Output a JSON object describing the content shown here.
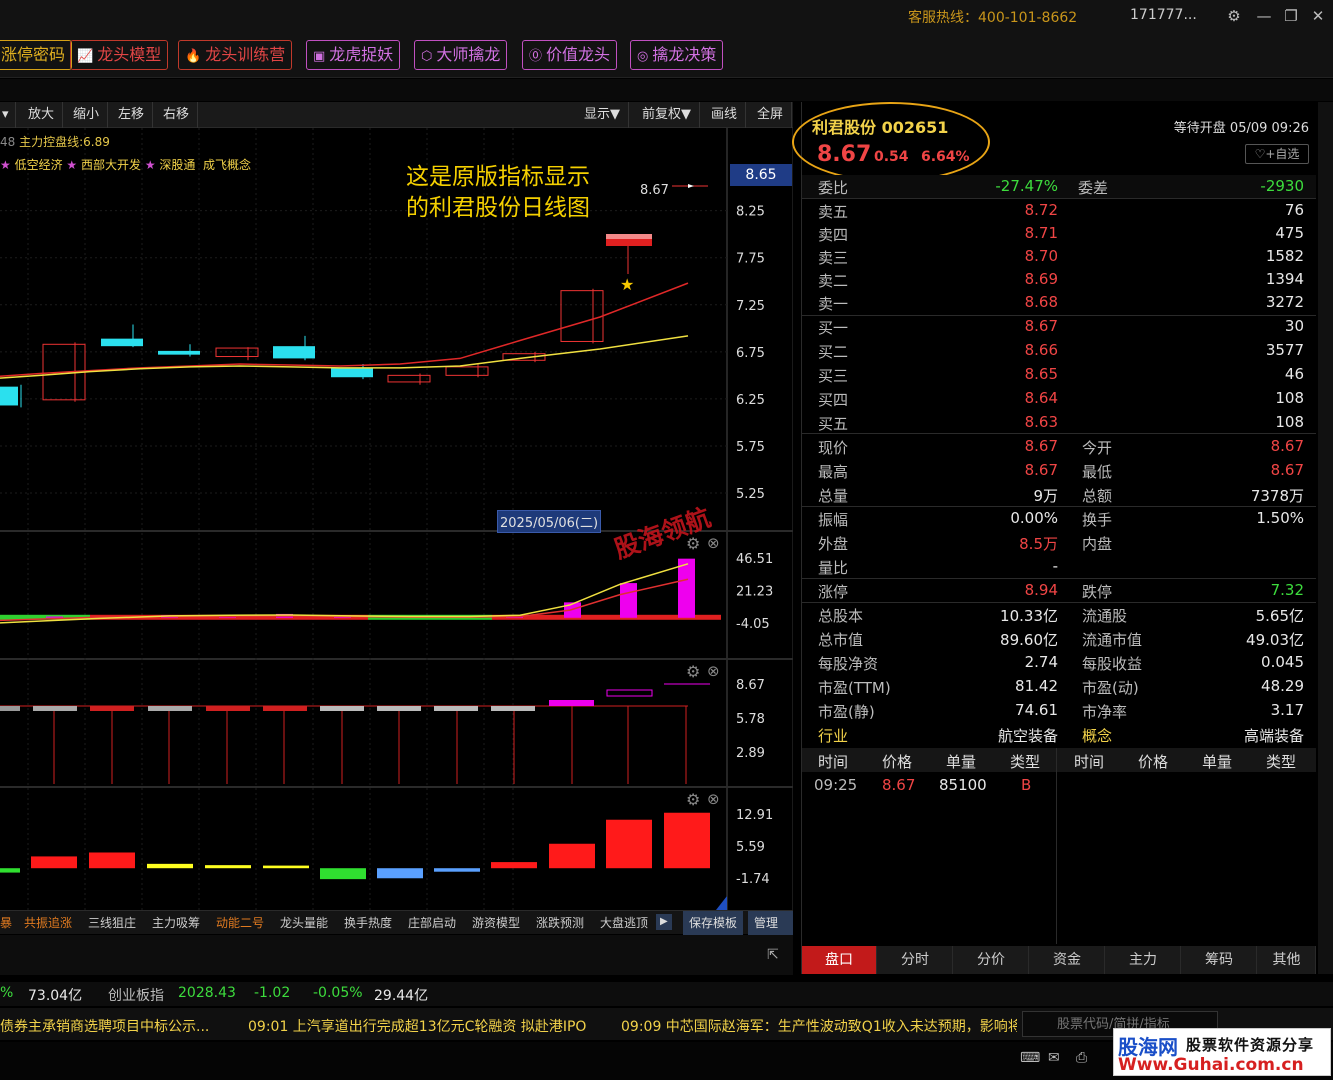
{
  "titlebar": {
    "hotline": "客服热线：400-101-8662",
    "account": "171777...",
    "settings_icon": "gear-icon",
    "minimize_icon": "minimize-icon",
    "restore_icon": "restore-icon",
    "close_icon": "close-icon"
  },
  "features": [
    {
      "label": "涨停密码",
      "icon": ""
    },
    {
      "label": "龙头模型",
      "icon": "chart-icon"
    },
    {
      "label": "龙头训练营",
      "icon": "fire-icon"
    },
    {
      "label": "龙虎捉妖",
      "icon": "frame-icon"
    },
    {
      "label": "大师擒龙",
      "icon": "cube-icon"
    },
    {
      "label": "价值龙头",
      "icon": "coin-icon"
    },
    {
      "label": "擒龙决策",
      "icon": "pulse-icon"
    }
  ],
  "chart_tools": {
    "zoom_in": "放大",
    "zoom_out": "缩小",
    "move_left": "左移",
    "move_right": "右移",
    "display": "显示▼",
    "adjust": "前复权▼",
    "draw": "画线",
    "fullscreen": "全屏"
  },
  "chart_header": {
    "indicator_prefix": "48",
    "indicator_label": "主力控盘线:6.89",
    "concepts": [
      "低空经济",
      "西部大开发",
      "深股通",
      "成飞概念"
    ],
    "annotation_line1": "这是原版指标显示",
    "annotation_line2": "的利君股份日线图",
    "price_tag": "8.65",
    "last_price_label": "8.67",
    "date_tag": "2025/05/06(二)",
    "watermark": "股海领航"
  },
  "chart_data": {
    "type": "candlestick",
    "main_y_ticks": [
      "8.25",
      "7.75",
      "7.25",
      "6.75",
      "6.25",
      "5.75",
      "5.25"
    ],
    "ylim": [
      5.25,
      8.65
    ],
    "candles": [
      {
        "open": 6.38,
        "close": 6.18,
        "high": 6.4,
        "low": 6.16
      },
      {
        "open": 6.24,
        "close": 6.83,
        "high": 6.85,
        "low": 6.22
      },
      {
        "open": 6.89,
        "close": 6.81,
        "high": 7.04,
        "low": 6.8
      },
      {
        "open": 6.76,
        "close": 6.72,
        "high": 6.83,
        "low": 6.7
      },
      {
        "open": 6.7,
        "close": 6.79,
        "high": 6.8,
        "low": 6.66
      },
      {
        "open": 6.81,
        "close": 6.68,
        "high": 6.92,
        "low": 6.66
      },
      {
        "open": 6.58,
        "close": 6.48,
        "high": 6.62,
        "low": 6.46
      },
      {
        "open": 6.43,
        "close": 6.5,
        "high": 6.52,
        "low": 6.4
      },
      {
        "open": 6.5,
        "close": 6.59,
        "high": 6.62,
        "low": 6.48
      },
      {
        "open": 6.66,
        "close": 6.73,
        "high": 6.75,
        "low": 6.64
      },
      {
        "open": 6.86,
        "close": 7.4,
        "high": 7.42,
        "low": 6.84
      },
      {
        "open": 8.67,
        "close": 8.67,
        "high": 8.67,
        "low": 8.67
      }
    ],
    "ma_red": [
      6.49,
      6.52,
      6.55,
      6.58,
      6.6,
      6.62,
      6.61,
      6.6,
      6.62,
      6.68,
      6.87,
      7.12,
      7.48
    ],
    "ma_yellow": [
      6.47,
      6.5,
      6.54,
      6.57,
      6.59,
      6.6,
      6.59,
      6.58,
      6.58,
      6.6,
      6.68,
      6.78,
      6.92
    ],
    "ind1_y_ticks": [
      "46.51",
      "21.23",
      "-4.05"
    ],
    "ind1_bars": [
      -1,
      1,
      1,
      2,
      2,
      3,
      1,
      -1,
      -1,
      1,
      12,
      27,
      46
    ],
    "ind2_y_ticks": [
      "8.67",
      "5.78",
      "2.89"
    ],
    "ind3_y_ticks": [
      "12.91",
      "5.59",
      "-1.74"
    ],
    "ind3_bars": [
      {
        "v": -0.5,
        "c": "#30e030"
      },
      {
        "v": 3.2,
        "c": "#ff1a1a"
      },
      {
        "v": 4.1,
        "c": "#ff1a1a"
      },
      {
        "v": 1.5,
        "c": "#ffff20"
      },
      {
        "v": 1.2,
        "c": "#ffff20"
      },
      {
        "v": 1.1,
        "c": "#ffff20"
      },
      {
        "v": -2.0,
        "c": "#30e030"
      },
      {
        "v": -1.8,
        "c": "#5aa0ff"
      },
      {
        "v": -0.3,
        "c": "#5aa0ff"
      },
      {
        "v": 1.9,
        "c": "#ff1a1a"
      },
      {
        "v": 6.1,
        "c": "#ff1a1a"
      },
      {
        "v": 11.6,
        "c": "#ff1a1a"
      },
      {
        "v": 13.2,
        "c": "#ff1a1a"
      }
    ]
  },
  "indicator_tabs": [
    {
      "label": "暴",
      "color": "orange"
    },
    {
      "label": "共振追涨",
      "color": "orange"
    },
    {
      "label": "三线狙庄",
      "color": "normal"
    },
    {
      "label": "主力吸筹",
      "color": "normal"
    },
    {
      "label": "动能二号",
      "color": "orange"
    },
    {
      "label": "龙头量能",
      "color": "normal"
    },
    {
      "label": "换手热度",
      "color": "normal"
    },
    {
      "label": "庄部启动",
      "color": "normal"
    },
    {
      "label": "游资模型",
      "color": "normal"
    },
    {
      "label": "涨跌预测",
      "color": "normal"
    },
    {
      "label": "大盘逃顶",
      "color": "normal"
    }
  ],
  "indicator_buttons": {
    "more": "▶",
    "save": "保存模板",
    "manage": "管理"
  },
  "quote": {
    "name": "利君股份 002651",
    "price": "8.67",
    "change": "0.54",
    "change_pct": "6.64%",
    "status": "等待开盘 05/09 09:26",
    "fav": "+自选",
    "weibi_label": "委比",
    "weibi": "-27.47%",
    "weicha_label": "委差",
    "weicha": "-2930",
    "asks": [
      {
        "label": "卖五",
        "price": "8.72",
        "vol": "76"
      },
      {
        "label": "卖四",
        "price": "8.71",
        "vol": "475"
      },
      {
        "label": "卖三",
        "price": "8.70",
        "vol": "1582"
      },
      {
        "label": "卖二",
        "price": "8.69",
        "vol": "1394"
      },
      {
        "label": "卖一",
        "price": "8.68",
        "vol": "3272"
      }
    ],
    "bids": [
      {
        "label": "买一",
        "price": "8.67",
        "vol": "30"
      },
      {
        "label": "买二",
        "price": "8.66",
        "vol": "3577"
      },
      {
        "label": "买三",
        "price": "8.65",
        "vol": "46"
      },
      {
        "label": "买四",
        "price": "8.64",
        "vol": "108"
      },
      {
        "label": "买五",
        "price": "8.63",
        "vol": "108"
      }
    ],
    "stats": [
      [
        {
          "l": "现价",
          "v": "8.67",
          "c": "red"
        },
        {
          "l": "今开",
          "v": "8.67",
          "c": "red"
        }
      ],
      [
        {
          "l": "最高",
          "v": "8.67",
          "c": "red"
        },
        {
          "l": "最低",
          "v": "8.67",
          "c": "red"
        }
      ],
      [
        {
          "l": "总量",
          "v": "9万",
          "c": "white"
        },
        {
          "l": "总额",
          "v": "7378万",
          "c": "white"
        }
      ],
      [
        {
          "l": "振幅",
          "v": "0.00%",
          "c": "white"
        },
        {
          "l": "换手",
          "v": "1.50%",
          "c": "white"
        }
      ],
      [
        {
          "l": "外盘",
          "v": "8.5万",
          "c": "red"
        },
        {
          "l": "内盘",
          "v": "",
          "c": "white"
        }
      ],
      [
        {
          "l": "量比",
          "v": "-",
          "c": "white"
        },
        {
          "l": "",
          "v": "",
          "c": "white"
        }
      ],
      [
        {
          "l": "涨停",
          "v": "8.94",
          "c": "red"
        },
        {
          "l": "跌停",
          "v": "7.32",
          "c": "green"
        }
      ],
      [
        {
          "l": "总股本",
          "v": "10.33亿",
          "c": "white"
        },
        {
          "l": "流通股",
          "v": "5.65亿",
          "c": "white"
        }
      ],
      [
        {
          "l": "总市值",
          "v": "89.60亿",
          "c": "white"
        },
        {
          "l": "流通市值",
          "v": "49.03亿",
          "c": "white"
        }
      ],
      [
        {
          "l": "每股净资",
          "v": "2.74",
          "c": "white"
        },
        {
          "l": "每股收益",
          "v": "0.045",
          "c": "white"
        }
      ],
      [
        {
          "l": "市盈(TTM)",
          "v": "81.42",
          "c": "white"
        },
        {
          "l": "市盈(动)",
          "v": "48.29",
          "c": "white"
        }
      ],
      [
        {
          "l": "市盈(静)",
          "v": "74.61",
          "c": "white"
        },
        {
          "l": "市净率",
          "v": "3.17",
          "c": "white"
        }
      ],
      [
        {
          "l": "行业",
          "v": "航空装备",
          "c": "white"
        },
        {
          "l": "概念",
          "v": "高端装备",
          "c": "white"
        }
      ]
    ],
    "tick_headers": [
      "时间",
      "价格",
      "单量",
      "类型",
      "时间",
      "价格",
      "单量",
      "类型"
    ],
    "ticks": [
      {
        "time": "09:25",
        "price": "8.67",
        "vol": "85100",
        "type": "B"
      }
    ],
    "tabs": [
      "盘口",
      "分时",
      "分价",
      "资金",
      "主力",
      "筹码",
      "其他"
    ]
  },
  "index_bar": {
    "pct0": "%",
    "amount0": "73.04亿",
    "name": "创业板指",
    "value": "2028.43",
    "change": "-1.02",
    "pct": "-0.05%",
    "amount": "29.44亿"
  },
  "news": [
    "债券主承销商选聘项目中标公示...",
    "09:01 上汽享道出行完成超13亿元C轮融资 拟赴港IPO",
    "09:09 中芯国际赵海军：生产性波动致Q1收入未达预期，影响将"
  ],
  "search": {
    "placeholder": "股票代码/简拼/指标"
  },
  "watermark_box": {
    "line1": "股海网",
    "line1b": "股票软件资源分享",
    "line2": "Www.Guhai.com.cn"
  }
}
